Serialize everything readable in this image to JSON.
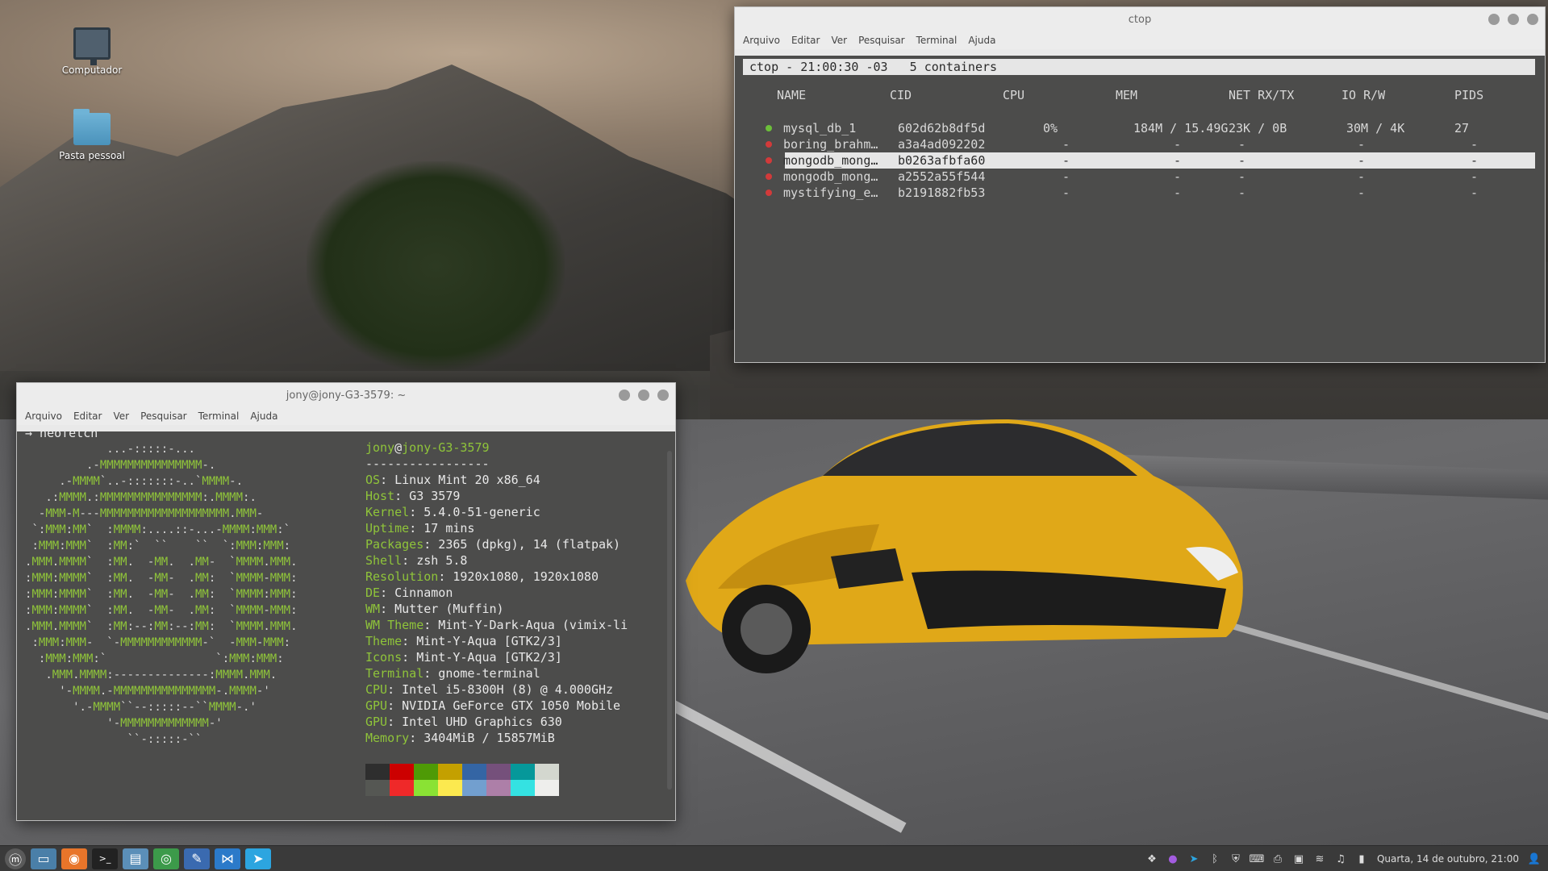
{
  "desktop": {
    "icons": [
      {
        "label": "Computador"
      },
      {
        "label": "Pasta pessoal"
      }
    ]
  },
  "ctop_window": {
    "title": "ctop",
    "menu": [
      "Arquivo",
      "Editar",
      "Ver",
      "Pesquisar",
      "Terminal",
      "Ajuda"
    ],
    "header": "ctop - 21:00:30 -03   5 containers",
    "columns": [
      "NAME",
      "CID",
      "CPU",
      "MEM",
      "NET RX/TX",
      "IO R/W",
      "PIDS"
    ],
    "rows": [
      {
        "name": "mysql_db_1",
        "cid": "602d62b8df5d",
        "cpu": "0%",
        "mem": "184M / 15.49G",
        "net": "23K / 0B",
        "io": "30M / 4K",
        "pids": "27",
        "status_color": "#6cbf3a"
      },
      {
        "name": "boring_brahm…",
        "cid": "a3a4ad092202",
        "cpu": "-",
        "mem": "-",
        "net": "-",
        "io": "-",
        "pids": "-",
        "status_color": "#d23a3a"
      },
      {
        "name": "mongodb_mong…",
        "cid": "b0263afbfa60",
        "cpu": "-",
        "mem": "-",
        "net": "-",
        "io": "-",
        "pids": "-",
        "status_color": "#d23a3a"
      },
      {
        "name": "mongodb_mong…",
        "cid": "a2552a55f544",
        "cpu": "-",
        "mem": "-",
        "net": "-",
        "io": "-",
        "pids": "-",
        "status_color": "#d23a3a"
      },
      {
        "name": "mystifying_e…",
        "cid": "b2191882fb53",
        "cpu": "-",
        "mem": "-",
        "net": "-",
        "io": "-",
        "pids": "-",
        "status_color": "#d23a3a"
      }
    ]
  },
  "neofetch_window": {
    "title": "jony@jony-G3-3579: ~",
    "menu": [
      "Arquivo",
      "Editar",
      "Ver",
      "Pesquisar",
      "Terminal",
      "Ajuda"
    ],
    "command": "→ neofetch",
    "user": "jony",
    "at": "@",
    "host": "jony-G3-3579",
    "separator": "-----------------",
    "info": [
      {
        "key": "OS",
        "value": " Linux Mint 20 x86_64"
      },
      {
        "key": "Host",
        "value": " G3 3579"
      },
      {
        "key": "Kernel",
        "value": " 5.4.0-51-generic"
      },
      {
        "key": "Uptime",
        "value": " 17 mins"
      },
      {
        "key": "Packages",
        "value": " 2365 (dpkg), 14 (flatpak)"
      },
      {
        "key": "Shell",
        "value": " zsh 5.8"
      },
      {
        "key": "Resolution",
        "value": " 1920x1080, 1920x1080"
      },
      {
        "key": "DE",
        "value": " Cinnamon"
      },
      {
        "key": "WM",
        "value": " Mutter (Muffin)"
      },
      {
        "key": "WM Theme",
        "value": " Mint-Y-Dark-Aqua (vimix-li"
      },
      {
        "key": "Theme",
        "value": " Mint-Y-Aqua [GTK2/3]"
      },
      {
        "key": "Icons",
        "value": " Mint-Y-Aqua [GTK2/3]"
      },
      {
        "key": "Terminal",
        "value": " gnome-terminal"
      },
      {
        "key": "CPU",
        "value": " Intel i5-8300H (8) @ 4.000GHz"
      },
      {
        "key": "GPU",
        "value": " NVIDIA GeForce GTX 1050 Mobile"
      },
      {
        "key": "GPU",
        "value": " Intel UHD Graphics 630"
      },
      {
        "key": "Memory",
        "value": " 3404MiB / 15857MiB"
      }
    ],
    "ascii": [
      "            ...-:::::-...",
      "         .-MMMMMMMMMMMMMMM-.",
      "     .-MMMM`..-:::::::-..`MMMM-.",
      "   .:MMMM.:MMMMMMMMMMMMMMM:.MMMM:.",
      "  -MMM-M---MMMMMMMMMMMMMMMMMMM.MMM-",
      " `:MMM:MM`  :MMMM:....::-...-MMMM:MMM:`",
      " :MMM:MMM`  :MM:`  ``    ``  `:MMM:MMM:",
      ".MMM.MMMM`  :MM.  -MM.  .MM-  `MMMM.MMM.",
      ":MMM:MMMM`  :MM.  -MM-  .MM:  `MMMM-MMM:",
      ":MMM:MMMM`  :MM.  -MM-  .MM:  `MMMM:MMM:",
      ":MMM:MMMM`  :MM.  -MM-  .MM:  `MMMM-MMM:",
      ".MMM.MMMM`  :MM:--:MM:--:MM:  `MMMM.MMM.",
      " :MMM:MMM-  `-MMMMMMMMMMMM-`  -MMM-MMM:",
      "  :MMM:MMM:`                `:MMM:MMM:",
      "   .MMM.MMMM:--------------:MMMM.MMM.",
      "     '-MMMM.-MMMMMMMMMMMMMMM-.MMMM-'",
      "       '.-MMMM``--:::::--``MMMM-.'",
      "            '-MMMMMMMMMMMMM-'",
      "               ``-:::::-``"
    ],
    "palette_top": [
      "#2e2e2e",
      "#cc0000",
      "#4e9a06",
      "#c4a000",
      "#3465a4",
      "#75507b",
      "#06989a",
      "#d3d7cf"
    ],
    "palette_bottom": [
      "#555753",
      "#ef2929",
      "#8ae234",
      "#fce94f",
      "#729fcf",
      "#ad7fa8",
      "#34e2e2",
      "#eeeeec"
    ]
  },
  "taskbar": {
    "apps": [
      {
        "icon": "mint-menu-icon",
        "color": "#5a5a5a"
      },
      {
        "icon": "show-desktop-icon",
        "color": "#4a7fa8"
      },
      {
        "icon": "firefox-icon",
        "color": "#e8752a"
      },
      {
        "icon": "terminal-icon",
        "color": "#222222"
      },
      {
        "icon": "files-icon",
        "color": "#5b8fb8"
      },
      {
        "icon": "chrome-icon",
        "color": "#3c9a4a"
      },
      {
        "icon": "app-launcher-icon",
        "color": "#3a6ab0"
      },
      {
        "icon": "vscode-icon",
        "color": "#2b7ac9"
      },
      {
        "icon": "telegram-icon",
        "color": "#2ca5e0"
      }
    ],
    "clock": "Quarta, 14 de outubro, 21:00"
  }
}
